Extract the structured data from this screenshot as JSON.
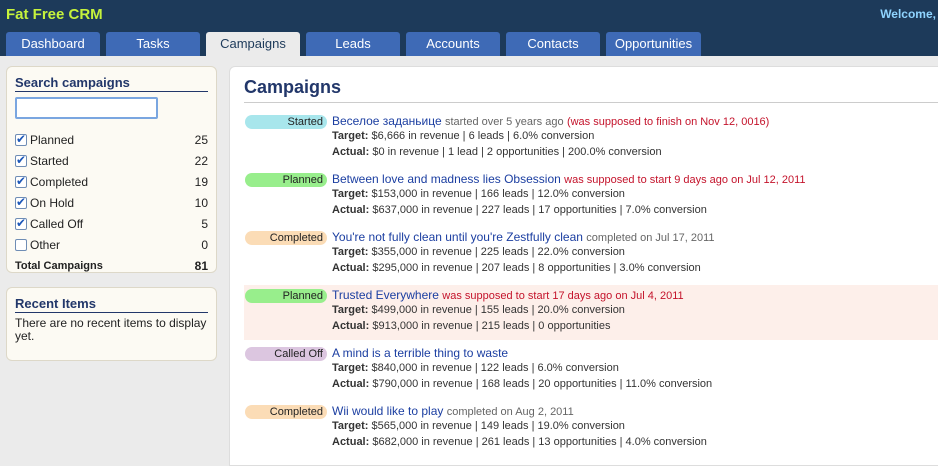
{
  "app": {
    "brand": "Fat Free CRM",
    "welcome": "Welcome,"
  },
  "tabs": [
    {
      "label": "Dashboard",
      "width": 94
    },
    {
      "label": "Tasks",
      "width": 94
    },
    {
      "label": "Campaigns",
      "width": 94,
      "active": true
    },
    {
      "label": "Leads",
      "width": 94
    },
    {
      "label": "Accounts",
      "width": 94
    },
    {
      "label": "Contacts",
      "width": 94
    },
    {
      "label": "Opportunities",
      "width": 95
    }
  ],
  "search": {
    "title": "Search campaigns",
    "value": "",
    "filters": [
      {
        "label": "Planned",
        "count": "25",
        "checked": true
      },
      {
        "label": "Started",
        "count": "22",
        "checked": true
      },
      {
        "label": "Completed",
        "count": "19",
        "checked": true
      },
      {
        "label": "On Hold",
        "count": "10",
        "checked": true
      },
      {
        "label": "Called Off",
        "count": "5",
        "checked": true
      },
      {
        "label": "Other",
        "count": "0",
        "checked": false
      }
    ],
    "total_label": "Total Campaigns",
    "total_count": "81"
  },
  "recent": {
    "title": "Recent Items",
    "text": "There are no recent items to display yet."
  },
  "main": {
    "title": "Campaigns",
    "campaigns": [
      {
        "status": "Started",
        "status_color": "#a8e6ec",
        "name": "Веселое заданьице",
        "note_plain": "started over 5 years ago",
        "note_late": "(was supposed to finish on Nov 12, 0016)",
        "target_label": "Target:",
        "target": "$6,666 in revenue | 6 leads | 6.0% conversion",
        "actual_label": "Actual:",
        "actual": "$0 in revenue | 1 lead | 2 opportunities | 200.0% conversion"
      },
      {
        "status": "Planned",
        "status_color": "#98ee8c",
        "name": "Between love and madness lies Obsession",
        "note_plain": "",
        "note_late": "was supposed to start 9 days ago on Jul 12, 2011",
        "target_label": "Target:",
        "target": "$153,000 in revenue | 166 leads | 12.0% conversion",
        "actual_label": "Actual:",
        "actual": "$637,000 in revenue | 227 leads | 17 opportunities | 7.0% conversion"
      },
      {
        "status": "Completed",
        "status_color": "#fbdcb6",
        "name": "You're not fully clean until you're Zestfully clean",
        "note_plain": "completed on Jul 17, 2011",
        "note_late": "",
        "target_label": "Target:",
        "target": "$355,000 in revenue | 225 leads | 22.0% conversion",
        "actual_label": "Actual:",
        "actual": "$295,000 in revenue | 207 leads | 8 opportunities | 3.0% conversion"
      },
      {
        "status": "Planned",
        "status_color": "#98ee8c",
        "name": "Trusted Everywhere",
        "note_plain": "",
        "note_late": "was supposed to start 17 days ago on Jul 4, 2011",
        "target_label": "Target:",
        "target": "$499,000 in revenue | 155 leads | 20.0% conversion",
        "actual_label": "Actual:",
        "actual": "$913,000 in revenue | 215 leads | 0 opportunities",
        "highlight": true
      },
      {
        "status": "Called Off",
        "status_color": "#dcc6e0",
        "name": "A mind is a terrible thing to waste",
        "note_plain": "",
        "note_late": "",
        "target_label": "Target:",
        "target": "$840,000 in revenue | 122 leads | 6.0% conversion",
        "actual_label": "Actual:",
        "actual": "$790,000 in revenue | 168 leads | 20 opportunities | 11.0% conversion"
      },
      {
        "status": "Completed",
        "status_color": "#fbdcb6",
        "name": "Wii would like to play",
        "note_plain": "completed on Aug 2, 2011",
        "note_late": "",
        "target_label": "Target:",
        "target": "$565,000 in revenue | 149 leads | 19.0% conversion",
        "actual_label": "Actual:",
        "actual": "$682,000 in revenue | 261 leads | 13 opportunities | 4.0% conversion"
      }
    ]
  }
}
